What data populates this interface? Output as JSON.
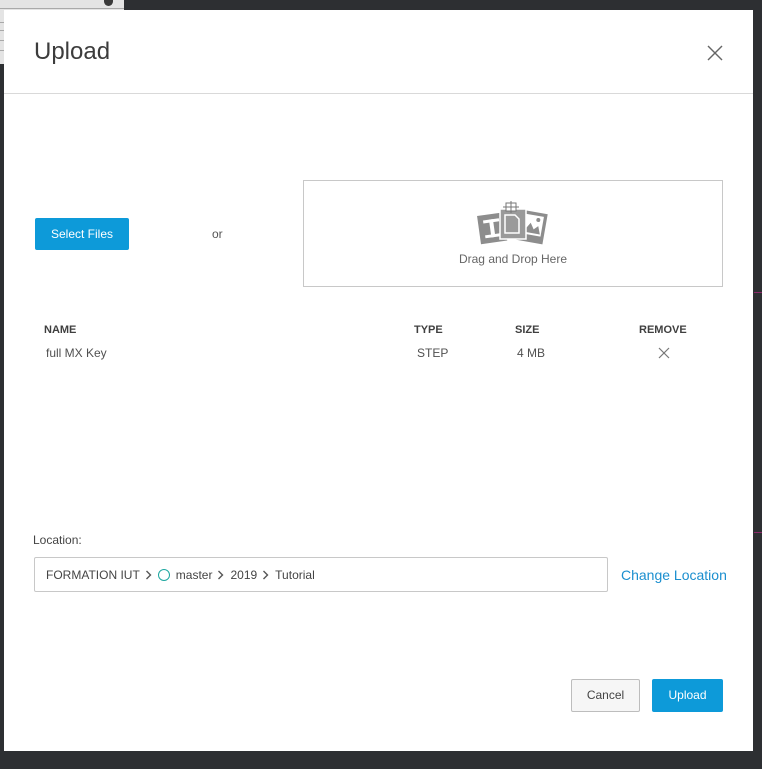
{
  "dialog": {
    "title": "Upload"
  },
  "actions": {
    "select_files_label": "Select Files",
    "or_label": "or",
    "drop_label": "Drag and Drop Here",
    "cancel_label": "Cancel",
    "upload_label": "Upload"
  },
  "file_table": {
    "columns": [
      "NAME",
      "TYPE",
      "SIZE",
      "REMOVE"
    ],
    "rows": [
      {
        "name": "full MX Key",
        "type": "STEP",
        "size": "4 MB"
      }
    ]
  },
  "location": {
    "label": "Location:",
    "path": [
      "FORMATION IUT",
      "master",
      "2019",
      "Tutorial"
    ],
    "change_label": "Change Location"
  },
  "colors": {
    "primary_button": "#0d9ad9",
    "link": "#1b8fcf",
    "folder_icon": "#1ea7a0",
    "backdrop": "#2d2f32"
  },
  "icons": {
    "close": "close-icon",
    "drop": "drag-drop-files-icon",
    "remove": "remove-x-icon",
    "chevron": "chevron-right-icon",
    "folder": "circle-folder-icon"
  }
}
